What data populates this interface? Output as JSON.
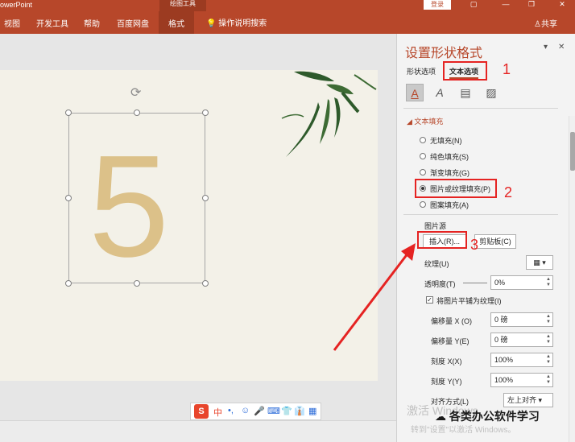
{
  "titlebar": {
    "app_name": "owerPoint",
    "context_tab": "绘图工具",
    "login": "登录",
    "btn_ribbon_opts": "▢",
    "btn_minimize": "—",
    "btn_restore": "❐",
    "btn_close": "✕",
    "accent": "#b7472a"
  },
  "ribbon": {
    "tabs": [
      "视图",
      "开发工具",
      "帮助",
      "百度网盘",
      "格式"
    ],
    "active_tab": "格式",
    "tell_me": "操作说明搜索",
    "share": "共享"
  },
  "slide": {
    "digit": "5"
  },
  "ime": {
    "items": [
      "S",
      "中",
      "•,",
      "☺",
      "🎤",
      "⌨",
      "👕",
      "👔",
      "▦"
    ]
  },
  "pane": {
    "title": "设置形状格式",
    "tabs": [
      "形状选项",
      "文本选项"
    ],
    "active_tab": "文本选项",
    "section": "文本填充",
    "fill_options": [
      "无填充(N)",
      "纯色填充(S)",
      "渐变填充(G)",
      "图片或纹理填充(P)",
      "图案填充(A)"
    ],
    "selected_fill": "图片或纹理填充(P)",
    "picture_source_label": "图片源",
    "insert_button": "插入(R)...",
    "clipboard_button": "剪贴板(C)",
    "texture_label": "纹理(U)",
    "transparency_label": "透明度(T)",
    "transparency_value": "0%",
    "tile_label": "将图片平铺为纹理(I)",
    "tile_checked": true,
    "offset_x_label": "偏移量 X (O)",
    "offset_x_value": "0 磅",
    "offset_y_label": "偏移量 Y(E)",
    "offset_y_value": "0 磅",
    "scale_x_label": "刻度 X(X)",
    "scale_x_value": "100%",
    "scale_y_label": "刻度 Y(Y)",
    "scale_y_value": "100%",
    "align_label": "对齐方式(L)",
    "align_value": "左上对齐"
  },
  "annotations": {
    "n1": "1",
    "n2": "2",
    "n3": "3",
    "color": "#e52322"
  },
  "watermark": {
    "line1": "激活 Windows",
    "line2": "转到\"设置\"以激活 Windows。",
    "badge": "各类办公软件学习"
  }
}
